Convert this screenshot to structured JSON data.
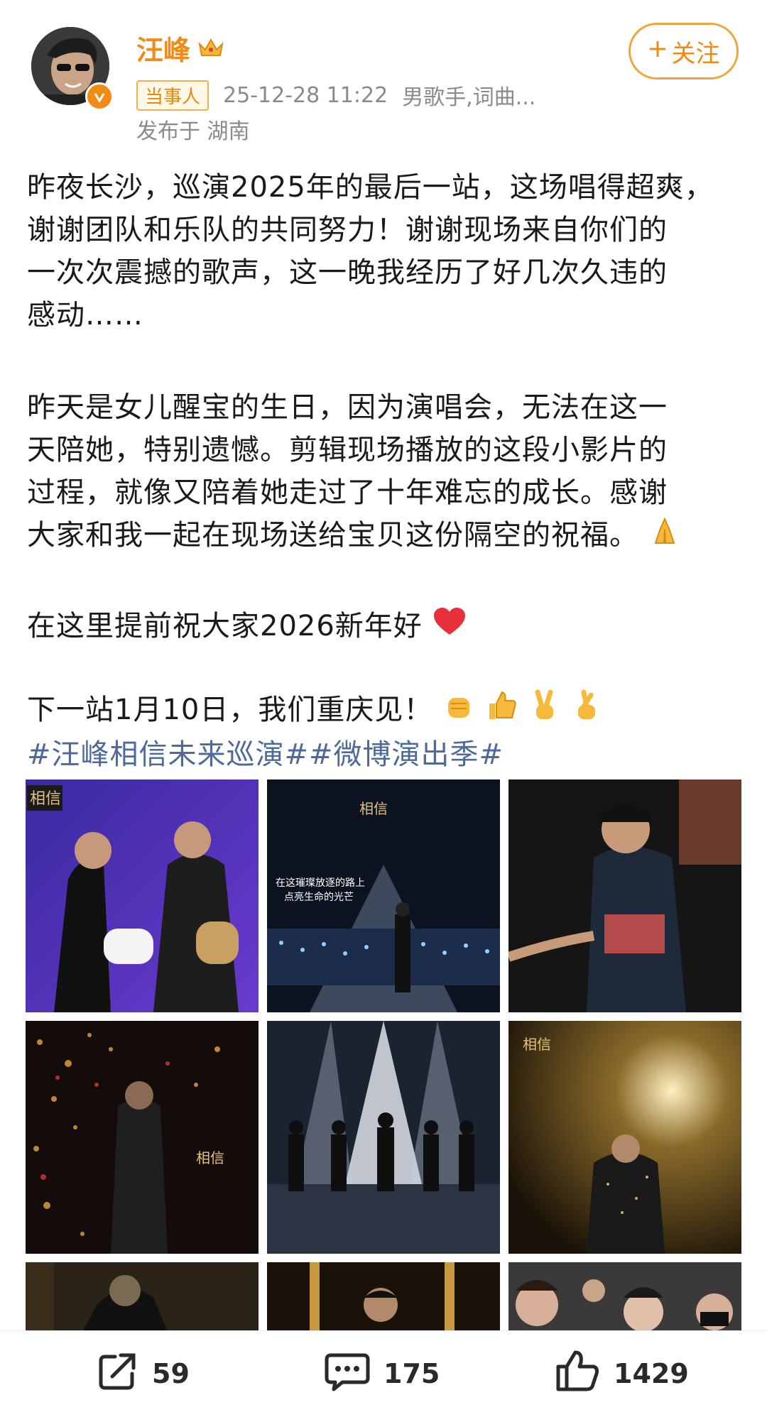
{
  "user": {
    "name": "汪峰",
    "tag": "当事人",
    "timestamp": "25-12-28 11:22",
    "bio": "男歌手,词曲...",
    "location": "发布于 湖南",
    "follow_label": "关注"
  },
  "post": {
    "p1": [
      "昨夜长沙，巡演2025年的最后一站，这场唱得超爽，",
      "谢谢团队和乐队的共同努力！谢谢现场来自你们的",
      "一次次震撼的歌声，这一晚我经历了好几次久违的",
      "感动……"
    ],
    "p2": [
      "昨天是女儿醒宝的生日，因为演唱会，无法在这一",
      "天陪她，特别遗憾。剪辑现场播放的这段小影片的",
      "过程，就像又陪着她走过了十年难忘的成长。感谢",
      "大家和我一起在现场送给宝贝这份隔空的祝福。"
    ],
    "p3": "在这里提前祝大家2026新年好",
    "p4": "下一站1月10日，我们重庆见！",
    "hashtags": "#汪峰相信未来巡演##微博演出季#"
  },
  "images": {
    "caption_2": [
      "在这璀璨放逐的路上",
      "点亮生命的光芒"
    ],
    "logo_text": "相信"
  },
  "actions": {
    "repost_count": "59",
    "comment_count": "175",
    "like_count": "1429"
  },
  "colors": {
    "accent": "#f28a16",
    "hashtag": "#4c6a9b"
  }
}
